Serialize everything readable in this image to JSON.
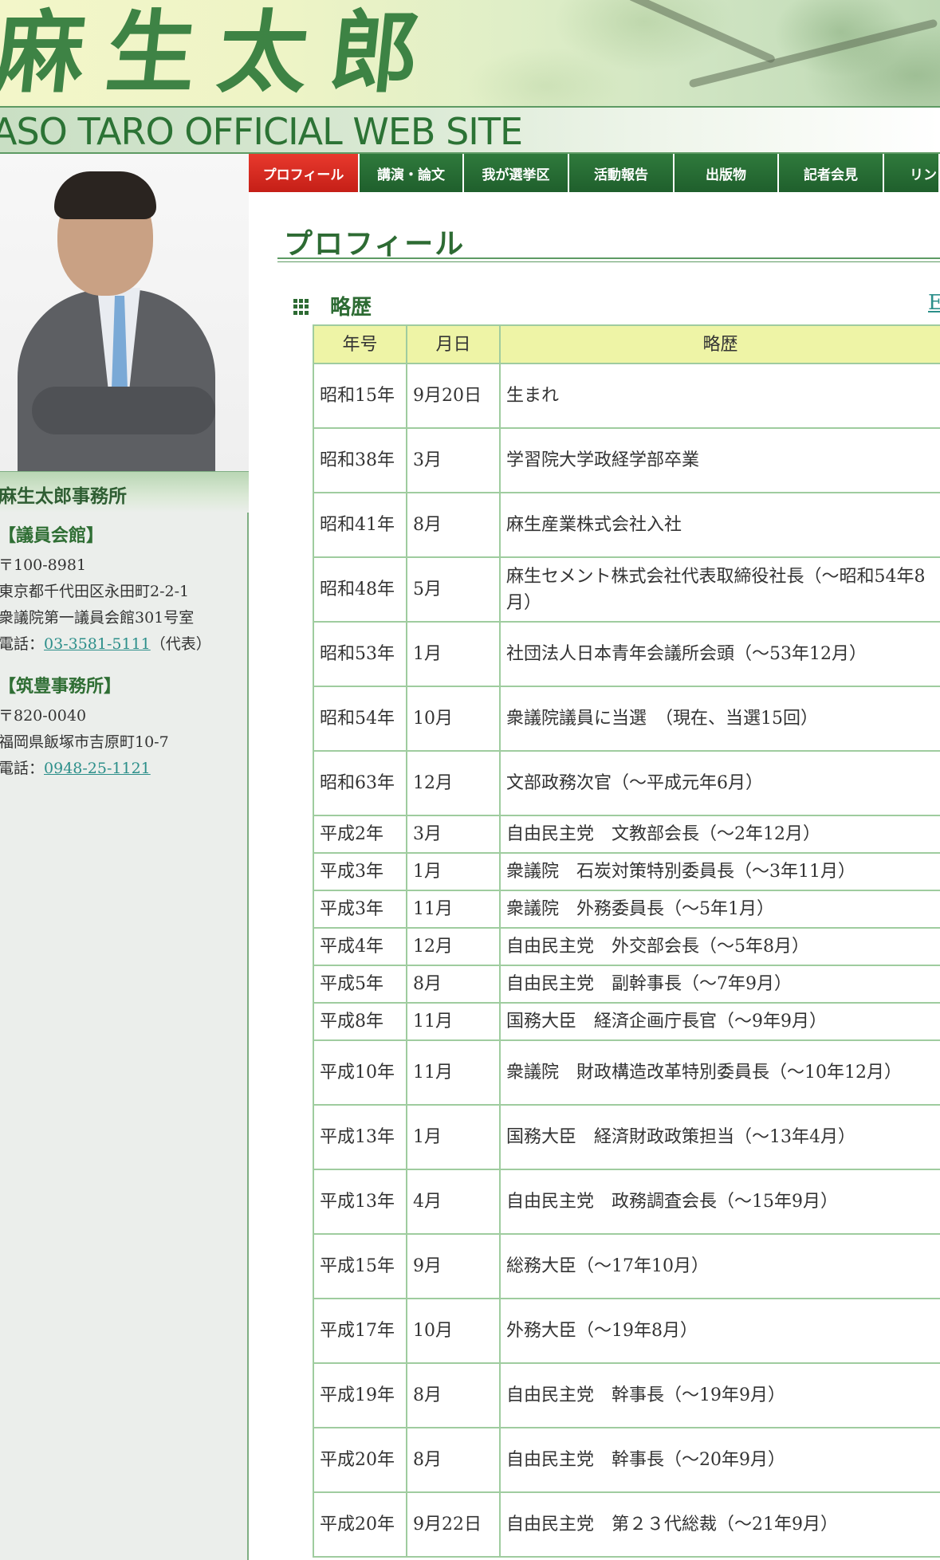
{
  "header": {
    "calligraphy": "麻生太郎",
    "site_title": "ASO TARO OFFICIAL WEB SITE"
  },
  "sidebar": {
    "office_title": "麻生太郎事務所",
    "offices": [
      {
        "name": "【議員会館】",
        "postal": "〒100-8981",
        "address1": "東京都千代田区永田町2-2-1",
        "address2": "衆議院第一議員会館301号室",
        "phone_label": "電話：",
        "phone": "03-3581-5111",
        "phone_suffix": "（代表）"
      },
      {
        "name": "【筑豊事務所】",
        "postal": "〒820-0040",
        "address1": "福岡県飯塚市吉原町10-7",
        "phone_label": "電話：",
        "phone": "0948-25-1121"
      }
    ]
  },
  "nav": {
    "tabs": [
      {
        "label": "プロフィール",
        "active": true
      },
      {
        "label": "講演・論文",
        "active": false
      },
      {
        "label": "我が選挙区",
        "active": false
      },
      {
        "label": "活動報告",
        "active": false
      },
      {
        "label": "出版物",
        "active": false
      },
      {
        "label": "記者会見",
        "active": false
      },
      {
        "label": "リン",
        "active": false
      }
    ]
  },
  "main": {
    "page_title": "プロフィール",
    "section_title": "略歴",
    "english_link": "E",
    "table": {
      "headers": [
        "年号",
        "月日",
        "略歴"
      ],
      "rows": [
        {
          "year": "昭和15年",
          "date": "9月20日",
          "event": "生まれ",
          "tall": true
        },
        {
          "year": "昭和38年",
          "date": "3月",
          "event": "学習院大学政経学部卒業",
          "tall": true
        },
        {
          "year": "昭和41年",
          "date": "8月",
          "event": "麻生産業株式会社入社",
          "tall": true
        },
        {
          "year": "昭和48年",
          "date": "5月",
          "event": "麻生セメント株式会社代表取締役社長（〜昭和54年8月）",
          "tall": true
        },
        {
          "year": "昭和53年",
          "date": "1月",
          "event": "社団法人日本青年会議所会頭（〜53年12月）",
          "tall": true
        },
        {
          "year": "昭和54年",
          "date": "10月",
          "event": "衆議院議員に当選　（現在、当選15回）",
          "tall": true
        },
        {
          "year": "昭和63年",
          "date": "12月",
          "event": "文部政務次官（〜平成元年6月）",
          "tall": true
        },
        {
          "year": "平成2年",
          "date": "3月",
          "event": "自由民主党　文教部会長（〜2年12月）",
          "tall": false
        },
        {
          "year": "平成3年",
          "date": "1月",
          "event": "衆議院　石炭対策特別委員長（〜3年11月）",
          "tall": false
        },
        {
          "year": "平成3年",
          "date": "11月",
          "event": "衆議院　外務委員長（〜5年1月）",
          "tall": false
        },
        {
          "year": "平成4年",
          "date": "12月",
          "event": "自由民主党　外交部会長（〜5年8月）",
          "tall": false
        },
        {
          "year": "平成5年",
          "date": "8月",
          "event": "自由民主党　副幹事長（〜7年9月）",
          "tall": false
        },
        {
          "year": "平成8年",
          "date": "11月",
          "event": "国務大臣　経済企画庁長官（〜9年9月）",
          "tall": false
        },
        {
          "year": "平成10年",
          "date": "11月",
          "event": "衆議院　財政構造改革特別委員長（〜10年12月）",
          "tall": true
        },
        {
          "year": "平成13年",
          "date": "1月",
          "event": "国務大臣　経済財政政策担当（〜13年4月）",
          "tall": true
        },
        {
          "year": "平成13年",
          "date": "4月",
          "event": "自由民主党　政務調査会長（〜15年9月）",
          "tall": true
        },
        {
          "year": "平成15年",
          "date": "9月",
          "event": "総務大臣（〜17年10月）",
          "tall": true
        },
        {
          "year": "平成17年",
          "date": "10月",
          "event": "外務大臣（〜19年8月）",
          "tall": true
        },
        {
          "year": "平成19年",
          "date": "8月",
          "event": "自由民主党　幹事長（〜19年9月）",
          "tall": true
        },
        {
          "year": "平成20年",
          "date": "8月",
          "event": "自由民主党　幹事長（〜20年9月）",
          "tall": true
        },
        {
          "year": "平成20年",
          "date": "9月22日",
          "event": "自由民主党　第２３代総裁（〜21年9月）",
          "tall": true
        }
      ]
    }
  },
  "colors": {
    "accent_green": "#2d6b33",
    "tab_green": "#1f5f2c",
    "tab_active_red": "#d72a20",
    "header_cell": "#eef4a6",
    "link": "#2c8f8a"
  }
}
